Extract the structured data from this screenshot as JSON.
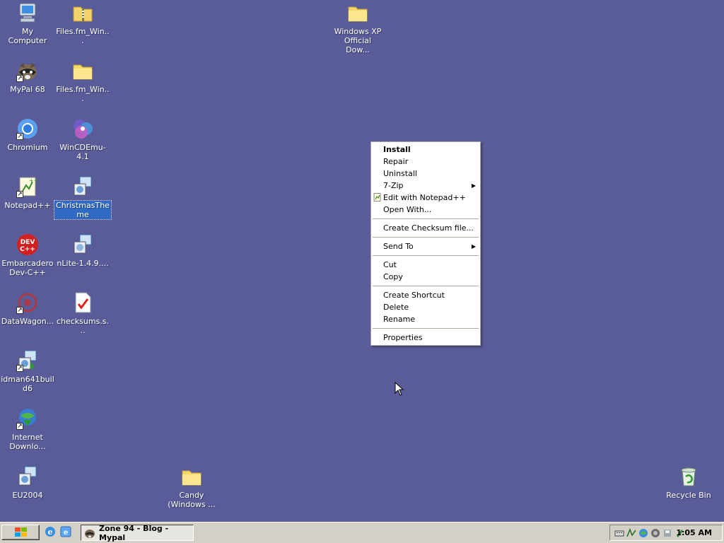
{
  "desktop": {
    "icons": [
      {
        "label": "My Computer",
        "icon": "my-computer-icon"
      },
      {
        "label": "Files.fm_Win...",
        "icon": "zip-folder-icon"
      },
      {
        "label": "Windows XP Official Dow...",
        "icon": "folder-icon"
      },
      {
        "label": "MyPal 68",
        "icon": "raccoon-browser-icon"
      },
      {
        "label": "Files.fm_Win...",
        "icon": "folder-icon"
      },
      {
        "label": "Chromium",
        "icon": "chromium-icon"
      },
      {
        "label": "WinCDEmu-4.1",
        "icon": "disc-icon"
      },
      {
        "label": "Notepad++",
        "icon": "notepad-plus-plus-icon"
      },
      {
        "label": "ChristmasTheme",
        "icon": "installer-icon"
      },
      {
        "label": "Embarcadero Dev-C++",
        "icon": "dev-cpp-icon"
      },
      {
        "label": "nLite-1.4.9....",
        "icon": "installer-icon"
      },
      {
        "label": "DataWagon...",
        "icon": "datawagon-icon"
      },
      {
        "label": "checksums.s...",
        "icon": "checksum-file-icon"
      },
      {
        "label": "idman641build6",
        "icon": "installer-icon"
      },
      {
        "label": "Internet Downlo...",
        "icon": "internet-download-manager-icon"
      },
      {
        "label": "EU2004",
        "icon": "installer-icon"
      },
      {
        "label": "Candy (Windows ...",
        "icon": "folder-icon"
      },
      {
        "label": "Recycle Bin",
        "icon": "recycle-bin-icon"
      }
    ]
  },
  "context_menu": {
    "items": [
      {
        "label": "Install",
        "bold": true
      },
      {
        "label": "Repair"
      },
      {
        "label": "Uninstall"
      },
      {
        "label": "7-Zip",
        "submenu": true
      },
      {
        "label": "Edit with Notepad++",
        "icon": "notepad-plus-plus-icon"
      },
      {
        "label": "Open With..."
      },
      {
        "label": "Create Checksum file..."
      },
      {
        "label": "Send To",
        "submenu": true
      },
      {
        "label": "Cut"
      },
      {
        "label": "Copy"
      },
      {
        "label": "Create Shortcut"
      },
      {
        "label": "Delete"
      },
      {
        "label": "Rename"
      },
      {
        "label": "Properties"
      }
    ],
    "arrow_glyph": "▶"
  },
  "taskbar": {
    "task_button_label": "Zone 94 - Blog - Mypal",
    "clock": "1:05 AM"
  },
  "colors": {
    "desktop_background": "#5a5c99",
    "selection": "#316ac5",
    "taskbar": "#d4d0c8"
  }
}
